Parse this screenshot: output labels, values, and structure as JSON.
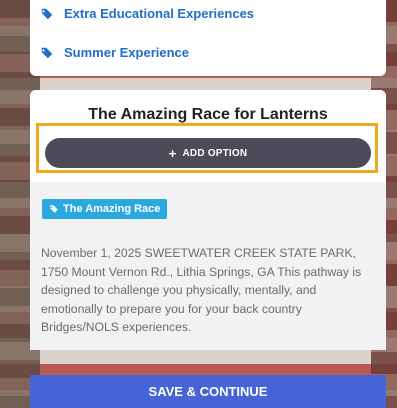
{
  "top_list": {
    "items": [
      {
        "label": "Extra Educational Experiences",
        "icon": "tags-icon"
      },
      {
        "label": "Summer Experience",
        "icon": "tags-icon"
      }
    ]
  },
  "event": {
    "title": "The Amazing Race for Lanterns",
    "add_option_label": "ADD OPTION",
    "category_badge": "The Amazing Race",
    "description": "November 1, 2025 SWEETWATER CREEK STATE PARK, 1750 Mount Vernon Rd., Lithia Springs, GA This pathway is designed to challenge you physically, mentally, and emotionally to prepare you for your back country Bridges/NOLS experiences."
  },
  "footer": {
    "save_label": "SAVE & CONTINUE"
  },
  "colors": {
    "link": "#1f6fc4",
    "highlight": "#f2a81d",
    "badge": "#29a9e0",
    "save_button": "#4664d6",
    "add_button": "#4b4b5a"
  }
}
